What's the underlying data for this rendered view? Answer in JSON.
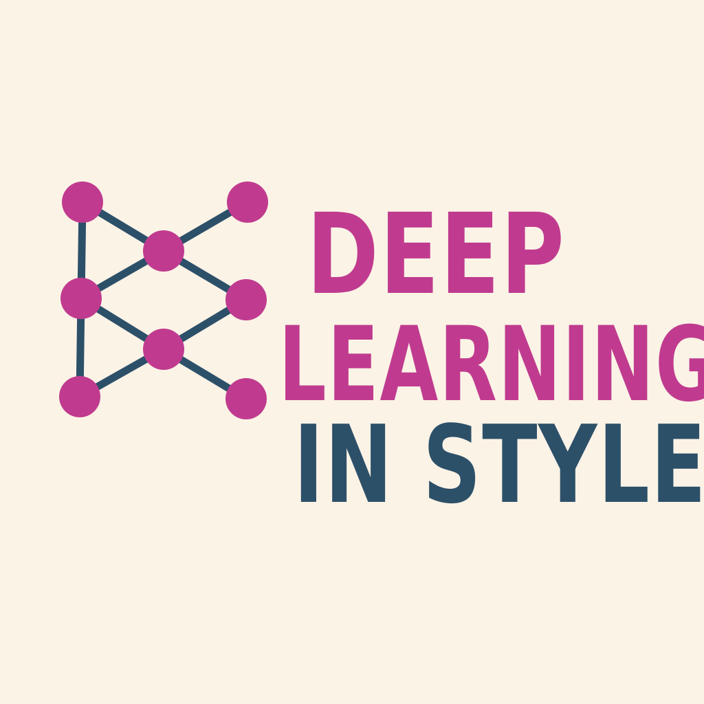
{
  "logo": {
    "line1": "DEEP",
    "line2": "LEARNING",
    "line3": "IN STYLE"
  },
  "colors": {
    "background": "#fbf3e6",
    "accent": "#c03b8f",
    "dark": "#2d5069"
  },
  "icon": "neural-network-icon"
}
